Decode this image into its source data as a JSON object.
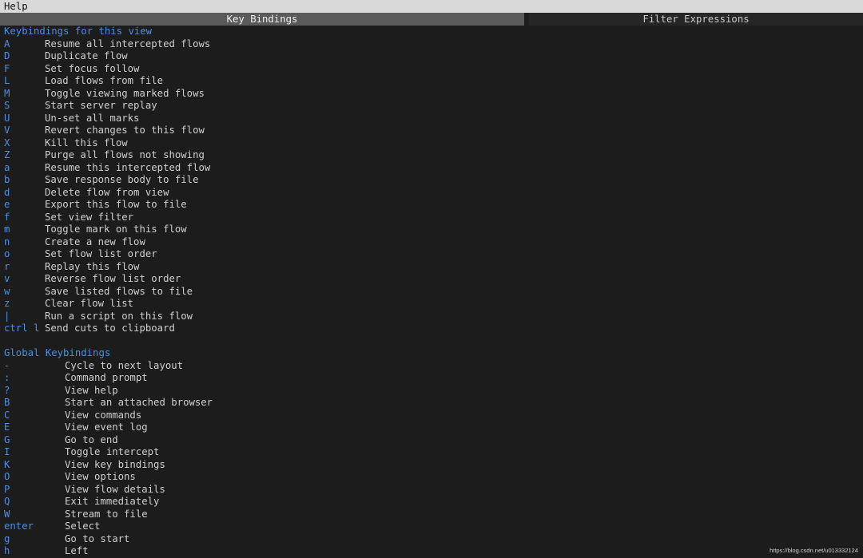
{
  "window": {
    "title": "Help"
  },
  "tabs": [
    {
      "label": "Key Bindings",
      "active": true
    },
    {
      "label": "Filter Expressions",
      "active": false
    }
  ],
  "view_section": {
    "heading": "Keybindings for this view",
    "bindings": [
      {
        "key": "A",
        "desc": "Resume all intercepted flows"
      },
      {
        "key": "D",
        "desc": "Duplicate flow"
      },
      {
        "key": "F",
        "desc": "Set focus follow"
      },
      {
        "key": "L",
        "desc": "Load flows from file"
      },
      {
        "key": "M",
        "desc": "Toggle viewing marked flows"
      },
      {
        "key": "S",
        "desc": "Start server replay"
      },
      {
        "key": "U",
        "desc": "Un-set all marks"
      },
      {
        "key": "V",
        "desc": "Revert changes to this flow"
      },
      {
        "key": "X",
        "desc": "Kill this flow"
      },
      {
        "key": "Z",
        "desc": "Purge all flows not showing"
      },
      {
        "key": "a",
        "desc": "Resume this intercepted flow"
      },
      {
        "key": "b",
        "desc": "Save response body to file"
      },
      {
        "key": "d",
        "desc": "Delete flow from view"
      },
      {
        "key": "e",
        "desc": "Export this flow to file"
      },
      {
        "key": "f",
        "desc": "Set view filter"
      },
      {
        "key": "m",
        "desc": "Toggle mark on this flow"
      },
      {
        "key": "n",
        "desc": "Create a new flow"
      },
      {
        "key": "o",
        "desc": "Set flow list order"
      },
      {
        "key": "r",
        "desc": "Replay this flow"
      },
      {
        "key": "v",
        "desc": "Reverse flow list order"
      },
      {
        "key": "w",
        "desc": "Save listed flows to file"
      },
      {
        "key": "z",
        "desc": "Clear flow list"
      },
      {
        "key": "|",
        "desc": "Run a script on this flow"
      },
      {
        "key": "ctrl l",
        "desc": "Send cuts to clipboard"
      }
    ]
  },
  "global_section": {
    "heading": "Global Keybindings",
    "bindings": [
      {
        "key": "-",
        "desc": "Cycle to next layout"
      },
      {
        "key": ":",
        "desc": "Command prompt"
      },
      {
        "key": "?",
        "desc": "View help"
      },
      {
        "key": "B",
        "desc": "Start an attached browser"
      },
      {
        "key": "C",
        "desc": "View commands"
      },
      {
        "key": "E",
        "desc": "View event log"
      },
      {
        "key": "G",
        "desc": "Go to end"
      },
      {
        "key": "I",
        "desc": "Toggle intercept"
      },
      {
        "key": "K",
        "desc": "View key bindings"
      },
      {
        "key": "O",
        "desc": "View options"
      },
      {
        "key": "P",
        "desc": "View flow details"
      },
      {
        "key": "Q",
        "desc": "Exit immediately"
      },
      {
        "key": "W",
        "desc": "Stream to file"
      },
      {
        "key": "enter",
        "desc": "Select"
      },
      {
        "key": "g",
        "desc": "Go to start"
      },
      {
        "key": "h",
        "desc": "Left"
      }
    ]
  },
  "watermark": "https://blog.csdn.net/u013332124",
  "colors": {
    "key": "#4e8ee0",
    "background": "#1c1c1c",
    "active_tab": "#5a5a5a",
    "title_bar": "#d9d9d9"
  }
}
